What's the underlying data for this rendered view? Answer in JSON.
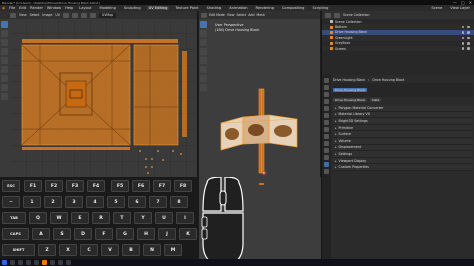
{
  "titlebar": {
    "title": "Blender* [C:\\Users\\...\\Desktop\\Mouse\\Drive Housing Black.blend]",
    "controls": [
      "—",
      "□",
      "✕"
    ]
  },
  "menubar": {
    "items": [
      "File",
      "Edit",
      "Render",
      "Window",
      "Help"
    ],
    "workspaces": [
      "Layout",
      "Modeling",
      "Sculpting",
      "UV Editing",
      "Texture Paint",
      "Shading",
      "Animation",
      "Rendering",
      "Compositing",
      "Scripting"
    ],
    "active_workspace": "UV Editing",
    "scene_label": "Scene",
    "viewlayer_label": "View Layer"
  },
  "uv_editor": {
    "view_label": "View",
    "select_label": "Select",
    "image_label": "Image",
    "uv_label": "UV",
    "image_name": "UVMap"
  },
  "viewport": {
    "mode_label": "Edit Mode",
    "view_label": "View",
    "select_label": "Select",
    "add_label": "Add",
    "mesh_label": "Mesh",
    "info_line1": "User Perspective",
    "info_line2": "(184) Drive Housing Black"
  },
  "outliner": {
    "header_label": "Scene Collection",
    "rows": [
      {
        "name": "Scene Collection",
        "icon": "collection-icon",
        "selected": false
      },
      {
        "name": "Bottom",
        "icon": "mesh-icon",
        "selected": false
      },
      {
        "name": "Drive Housing Black",
        "icon": "mesh-icon",
        "selected": true
      },
      {
        "name": "GreenLight",
        "icon": "mesh-icon",
        "selected": false
      },
      {
        "name": "GreyBack",
        "icon": "mesh-icon",
        "selected": false
      },
      {
        "name": "Screen",
        "icon": "mesh-icon",
        "selected": false
      }
    ]
  },
  "properties": {
    "object_name": "Drive Housing Black",
    "object_data_name": "Drive Housing Black",
    "material_field": "Drive Housing Black",
    "data_label": "Data",
    "panels": [
      "Polygon Material Converter",
      "Material Library VX",
      "Bright3D Settings",
      "Primitive",
      "Surface",
      "Volume",
      "Displacement",
      "Settings",
      "Viewport Display",
      "Custom Properties"
    ]
  },
  "keyboard": {
    "rows": [
      [
        "ESC",
        "F1",
        "F2",
        "F3",
        "F4",
        "F5",
        "F6",
        "F7",
        "F8"
      ],
      [
        "~",
        "1",
        "2",
        "3",
        "4",
        "5",
        "6",
        "7",
        "8"
      ],
      [
        "TAB",
        "Q",
        "W",
        "E",
        "R",
        "T",
        "Y",
        "U",
        "I"
      ],
      [
        "CAPS",
        "A",
        "S",
        "D",
        "F",
        "G",
        "H",
        "J",
        "K"
      ],
      [
        "SHIFT",
        "Z",
        "X",
        "C",
        "V",
        "B",
        "N",
        "M"
      ],
      [
        "CTRL",
        "WIN",
        "ALT",
        "SPACE"
      ]
    ]
  },
  "colors": {
    "uv_orange": "#e8821e",
    "selection_blue": "#334d80",
    "accent_blue": "#4772b3",
    "outline_orange": "#f29a2e"
  }
}
